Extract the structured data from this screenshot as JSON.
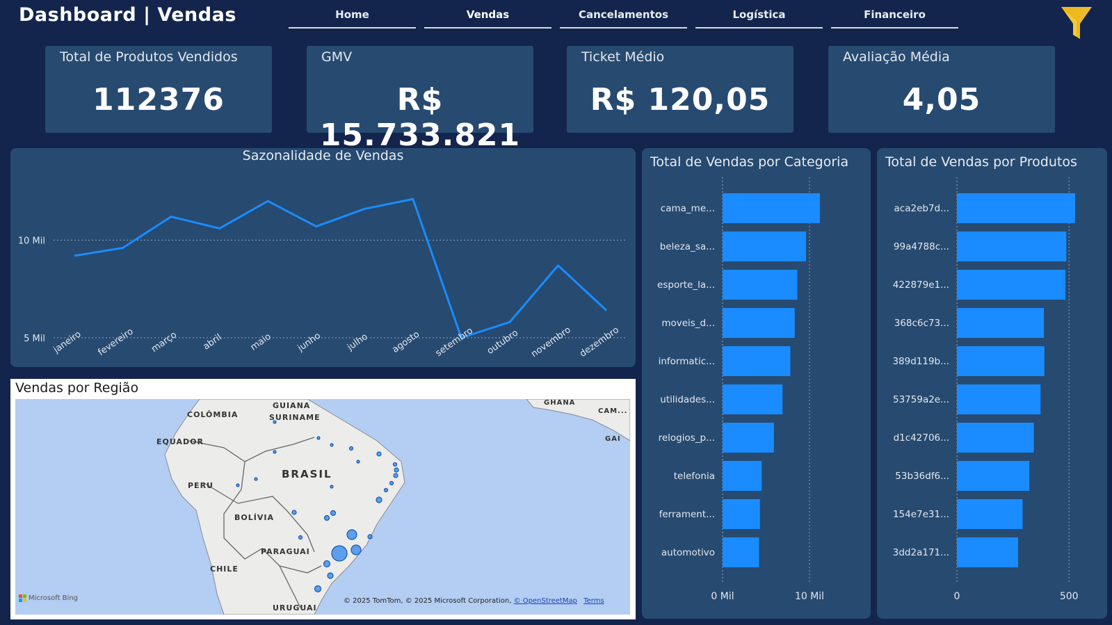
{
  "header": {
    "title": "Dashboard | Vendas",
    "nav": [
      {
        "label": "Home"
      },
      {
        "label": "Vendas"
      },
      {
        "label": "Cancelamentos"
      },
      {
        "label": "Logística"
      },
      {
        "label": "Financeiro"
      }
    ],
    "active_tab": "Vendas",
    "filter_icon": "funnel-icon"
  },
  "kpis": [
    {
      "label": "Total de Produtos Vendidos",
      "value": "112376"
    },
    {
      "label": "GMV",
      "value": "R$ 15.733.821"
    },
    {
      "label": "Ticket Médio",
      "value": "R$ 120,05"
    },
    {
      "label": "Avaliação Média",
      "value": "4,05"
    }
  ],
  "colors": {
    "background": "#13254d",
    "panel": "#274a70",
    "accent": "#1a8cff",
    "line": "#1a8cff"
  },
  "chart_data": [
    {
      "type": "line",
      "title": "Sazonalidade de Vendas",
      "categories": [
        "janeiro",
        "fevereiro",
        "março",
        "abril",
        "maio",
        "junho",
        "julho",
        "agosto",
        "setembro",
        "outubro",
        "novembro",
        "dezembro"
      ],
      "values": [
        9200,
        9600,
        11200,
        10600,
        12000,
        10700,
        11600,
        12100,
        5000,
        5800,
        8700,
        6400
      ],
      "yticks": [
        {
          "value": 5000,
          "label": "5 Mil"
        },
        {
          "value": 10000,
          "label": "10 Mil"
        }
      ],
      "ylim": [
        3500,
        14000
      ],
      "grid": true
    },
    {
      "type": "bar",
      "title": "Total de Vendas por Categoria",
      "categories": [
        "cama_me...",
        "beleza_sa...",
        "esporte_la...",
        "moveis_d...",
        "informatic...",
        "utilidades...",
        "relogios_p...",
        "telefonia",
        "ferrament...",
        "automotivo"
      ],
      "values": [
        11200,
        9600,
        8600,
        8300,
        7800,
        6900,
        5900,
        4500,
        4300,
        4200
      ],
      "xticks": [
        {
          "value": 0,
          "label": "0 Mil"
        },
        {
          "value": 10000,
          "label": "10 Mil"
        }
      ],
      "xlim": [
        0,
        12500
      ],
      "orientation": "horizontal"
    },
    {
      "type": "bar",
      "title": "Total de Vendas por Produtos",
      "categories": [
        "aca2eb7d...",
        "99a4788c...",
        "422879e1...",
        "368c6c73...",
        "389d119b...",
        "53759a2e...",
        "d1c42706...",
        "53b36df6...",
        "154e7e31...",
        "3dd2a171..."
      ],
      "values": [
        527,
        488,
        484,
        388,
        390,
        373,
        343,
        323,
        293,
        273
      ],
      "xticks": [
        {
          "value": 0,
          "label": "0"
        },
        {
          "value": 500,
          "label": "500"
        }
      ],
      "xlim": [
        0,
        580
      ],
      "orientation": "horizontal"
    }
  ],
  "map": {
    "title": "Vendas por Região",
    "labels": [
      "COLÔMBIA",
      "GUIANA",
      "SURINAME",
      "EQUADOR",
      "BRASIL",
      "PERU",
      "BOLÍVIA",
      "PARAGUAI",
      "CHILE",
      "URUGUAI",
      "GHANA",
      "CAM...",
      "GAI"
    ],
    "logo": "Microsoft Bing",
    "copyright": "© 2025 TomTom, © 2025 Microsoft Corporation, ",
    "osm_link": "© OpenStreetMap",
    "terms_link": "Terms"
  }
}
